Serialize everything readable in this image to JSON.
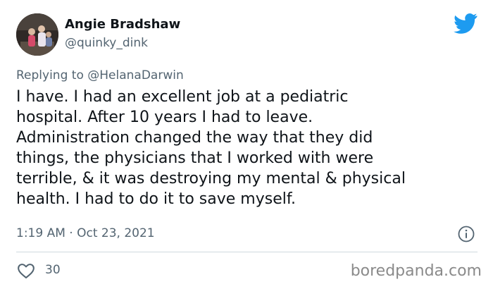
{
  "author": {
    "display_name": "Angie Bradshaw",
    "handle": "@quinky_dink",
    "avatar_icon": "profile-photo"
  },
  "brand": {
    "logo_icon": "twitter-bird-icon",
    "color": "#1d9bf0"
  },
  "reply": {
    "prefix": "Replying to ",
    "mention": "@HelanaDarwin"
  },
  "tweet": {
    "lines": [
      "I have. I had an excellent job at a pediatric",
      "hospital. After 10 years I had to leave.",
      "Administration changed the way that they did",
      "things, the physicians that I worked with were",
      "terrible, & it was destroying my mental & physical",
      "health. I had to do it to save myself."
    ]
  },
  "meta": {
    "timestamp": "1:19 AM · Oct 23, 2021",
    "info_icon": "info-icon"
  },
  "engagement": {
    "like_icon": "heart-icon",
    "likes": "30"
  },
  "watermark": "boredpanda.com"
}
